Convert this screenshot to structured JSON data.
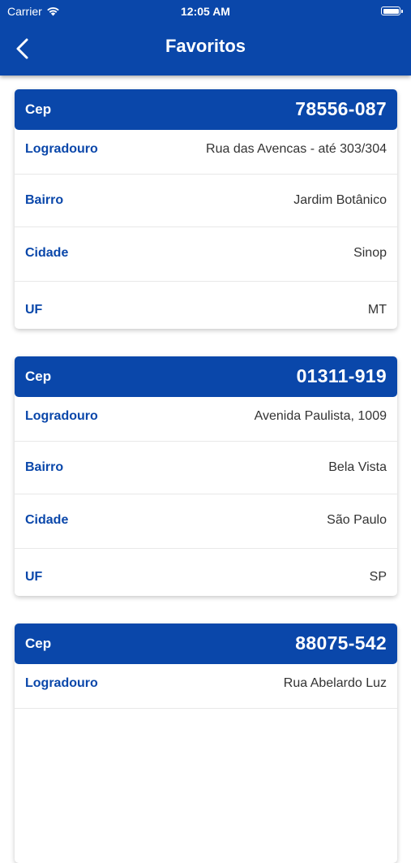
{
  "status_bar": {
    "carrier": "Carrier",
    "time": "12:05 AM"
  },
  "header": {
    "title": "Favoritos"
  },
  "colors": {
    "primary": "#0a47aa",
    "label": "#0a47aa",
    "value": "#333333"
  },
  "cards": [
    {
      "cep_label": "Cep",
      "cep": "78556-087",
      "rows": [
        {
          "label": "Logradouro",
          "value": "Rua das Avencas - até 303/304"
        },
        {
          "label": "Bairro",
          "value": "Jardim Botânico"
        },
        {
          "label": "Cidade",
          "value": "Sinop"
        },
        {
          "label": "UF",
          "value": "MT"
        }
      ]
    },
    {
      "cep_label": "Cep",
      "cep": "01311-919",
      "rows": [
        {
          "label": "Logradouro",
          "value": "Avenida Paulista, 1009"
        },
        {
          "label": "Bairro",
          "value": "Bela Vista"
        },
        {
          "label": "Cidade",
          "value": "São Paulo"
        },
        {
          "label": "UF",
          "value": "SP"
        }
      ]
    },
    {
      "cep_label": "Cep",
      "cep": "88075-542",
      "rows": [
        {
          "label": "Logradouro",
          "value": "Rua Abelardo Luz"
        }
      ]
    }
  ]
}
